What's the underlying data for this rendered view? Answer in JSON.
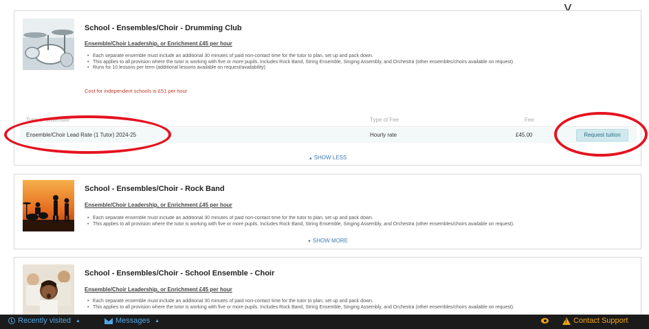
{
  "top_fragment": "y",
  "cards": [
    {
      "title": "School - Ensembles/Choir - Drumming Club",
      "subtitle": "Ensemble/Choir Leadership, or Enrichment £45 per hour",
      "bullets": [
        "Each separate ensemble must include an additional 30 minutes of paid non-contact time for the tutor to plan, set up and pack down.",
        "This applies to all provision where the tutor is working with five or more pupils. Includes Rock Band, String Ensemble, Singing Assembly, and Orchestra (other ensembles/choirs available on request).",
        "Runs for 10 lessons per term (additional lessons available on request/availability)"
      ],
      "cost_note": "Cost for independent schools is £51 per hour",
      "fee_table": {
        "headers": [
          "Type of ensemble",
          "Type of Fee",
          "Fee"
        ],
        "rows": [
          {
            "name": "Ensemble/Choir Lead Rate (1 Tutor) 2024-25",
            "fee_type": "Hourly rate",
            "fee": "£45.00",
            "action": "Request tuition"
          }
        ]
      },
      "toggle": "SHOW LESS",
      "image_icon": "drum-kit-photo"
    },
    {
      "title": "School - Ensembles/Choir - Rock Band",
      "subtitle": "Ensemble/Choir Leadership, or Enrichment £45 per hour",
      "bullets": [
        "Each separate ensemble must include an additional 30 minutes of paid non-contact time for the tutor to plan, set up and pack down.",
        "This applies to all provision where the tutor is working with five or more pupils. Includes Rock Band, String Ensemble, Singing Assembly, and Orchestra (other ensembles/choirs available on request)."
      ],
      "toggle": "SHOW MORE",
      "image_icon": "rock-band-silhouette-photo"
    },
    {
      "title": "School - Ensembles/Choir - School Ensemble - Choir",
      "subtitle": "Ensemble/Choir Leadership, or Enrichment £45 per hour",
      "bullets": [
        "Each separate ensemble must include an additional 30 minutes of paid non-contact time for the tutor to plan, set up and pack down.",
        "This applies to all provision where the tutor is working with five or more pupils. Includes Rock Band, String Ensemble, Singing Assembly, and Orchestra (other ensembles/choirs available on request)."
      ],
      "image_icon": "choir-children-photo"
    }
  ],
  "bottom_bar": {
    "recently_visited": "Recently visited",
    "messages": "Messages",
    "contact_support": "Contact Support"
  },
  "colors": {
    "annotation": "#e4131f",
    "link": "#3b7bb0",
    "cost_note": "#c0392b",
    "bottom_bar_bg": "#1b1b1b",
    "bottom_bar_link": "#4ea6e4",
    "support": "#f2a516"
  }
}
